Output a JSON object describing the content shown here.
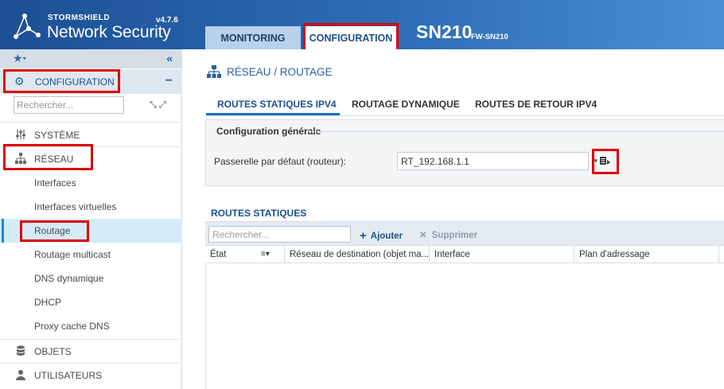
{
  "header": {
    "brand_top": "STORMSHIELD",
    "brand_name": "Network Security",
    "version": "v4.7.6",
    "tabs": [
      {
        "label": "MONITORING"
      },
      {
        "label": "CONFIGURATION",
        "active": true
      }
    ],
    "model": "SN210",
    "hostname": "FW-SN210"
  },
  "sidebar": {
    "favorites_icon": "star-icon",
    "collapse_icon": "double-chevron-left-icon",
    "module_label": "CONFIGURATION",
    "search_placeholder": "Rechercher...",
    "categories": [
      {
        "label": "SYSTÈME",
        "icon": "sliders-icon"
      },
      {
        "label": "RÉSEAU",
        "icon": "network-icon"
      },
      {
        "label": "OBJETS",
        "icon": "database-icon"
      },
      {
        "label": "UTILISATEURS",
        "icon": "user-icon"
      }
    ],
    "network_items": [
      {
        "label": "Interfaces"
      },
      {
        "label": "Interfaces virtuelles"
      },
      {
        "label": "Routage",
        "active": true
      },
      {
        "label": "Routage multicast"
      },
      {
        "label": "DNS dynamique"
      },
      {
        "label": "DHCP"
      },
      {
        "label": "Proxy cache DNS"
      }
    ]
  },
  "main": {
    "title": "RÉSEAU / ROUTAGE",
    "subtabs": [
      {
        "label": "ROUTES STATIQUES IPV4",
        "active": true
      },
      {
        "label": "ROUTAGE DYNAMIQUE"
      },
      {
        "label": "ROUTES DE RETOUR IPV4"
      }
    ],
    "general": {
      "legend": "Configuration générale",
      "gateway_label": "Passerelle par défaut (routeur):",
      "gateway_value": "RT_192.168.1.1"
    },
    "static_routes": {
      "title": "ROUTES STATIQUES",
      "search_placeholder": "Rechercher...",
      "add_label": "Ajouter",
      "delete_label": "Supprimer",
      "columns": [
        {
          "label": "État"
        },
        {
          "label": "Réseau de destination (objet ma..."
        },
        {
          "label": "Interface"
        },
        {
          "label": "Plan d'adressage"
        }
      ]
    }
  },
  "colors": {
    "header_start": "#1d4f94",
    "header_end": "#4b8fd6",
    "accent": "#1e4f8c",
    "highlight": "#e00000",
    "active_item": "#d4ecf8"
  }
}
